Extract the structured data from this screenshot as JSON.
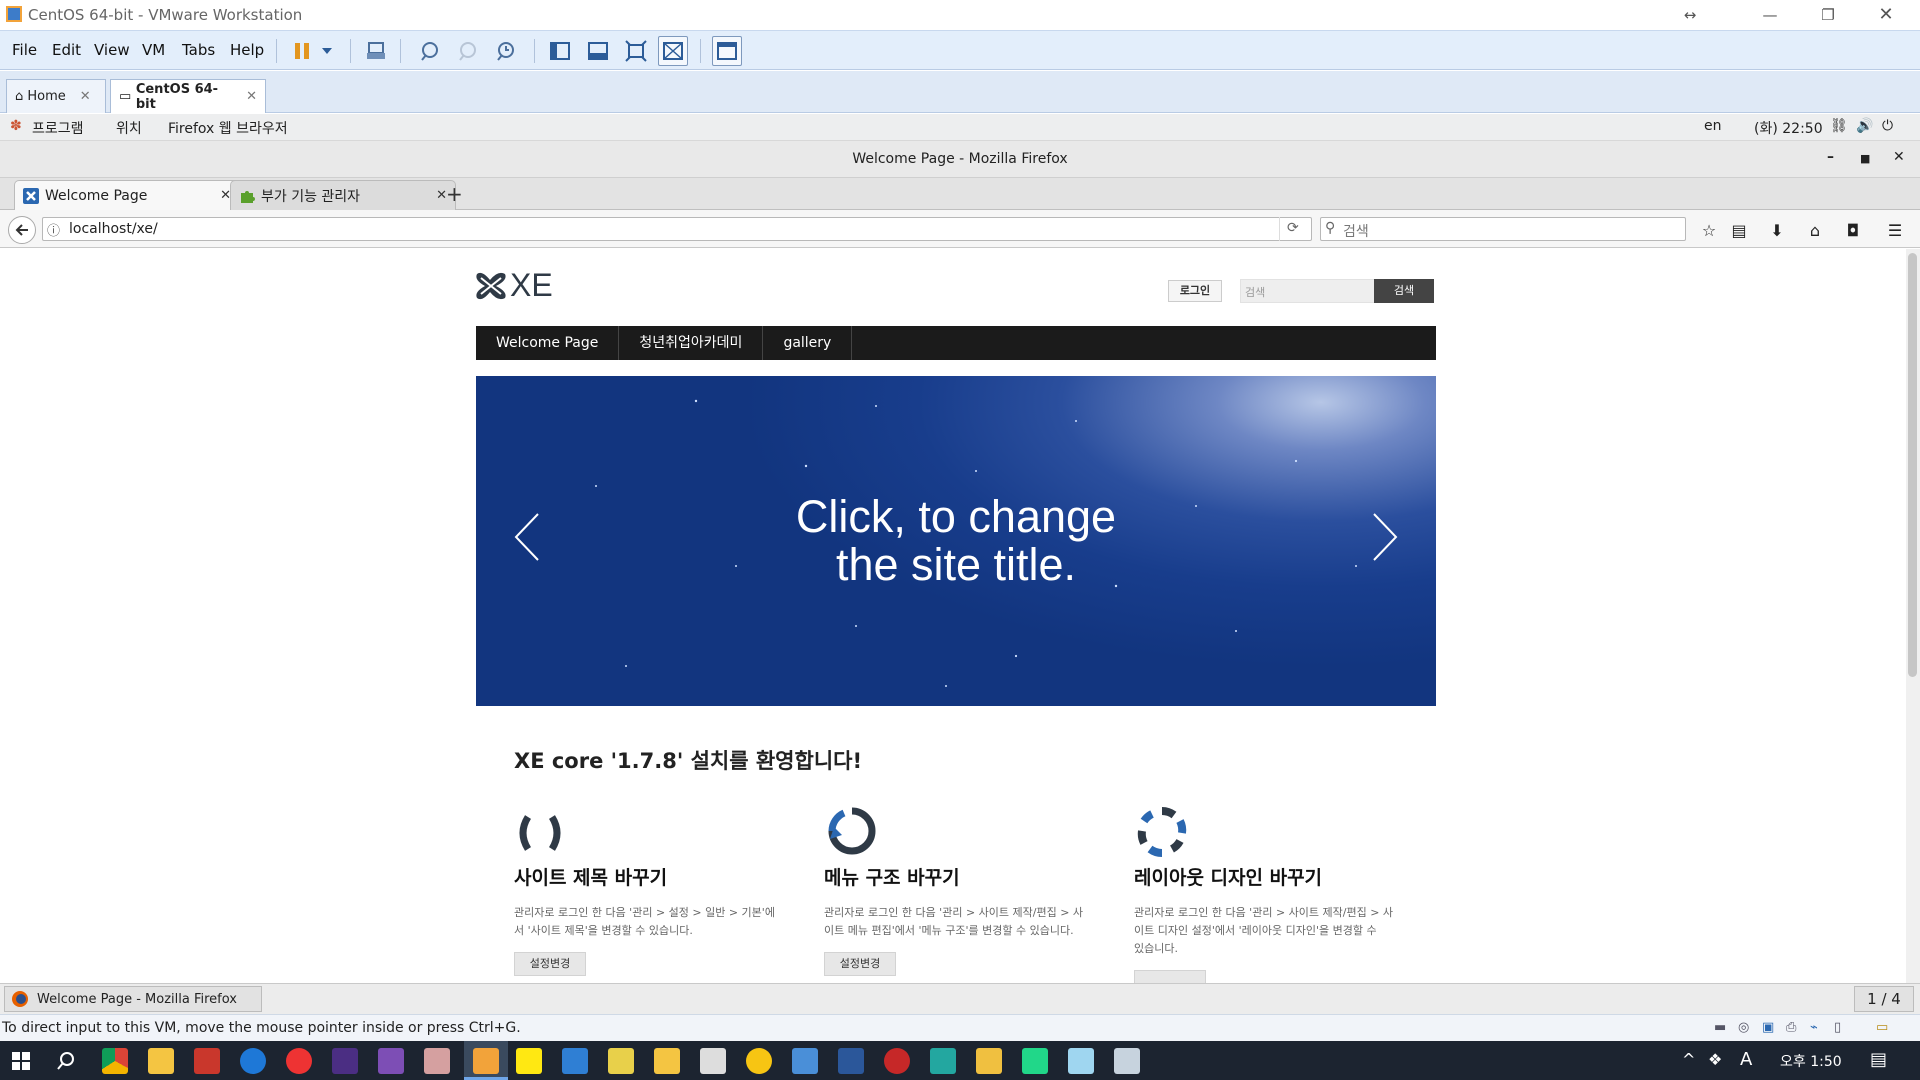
{
  "vmware": {
    "title": "CentOS 64-bit - VMware Workstation",
    "menu": [
      "File",
      "Edit",
      "View",
      "VM",
      "Tabs",
      "Help"
    ],
    "tabs": [
      {
        "label": "Home"
      },
      {
        "label": "CentOS 64-bit",
        "active": true
      }
    ],
    "status_message": "To direct input to this VM, move the mouse pointer inside or press Ctrl+G."
  },
  "gnome": {
    "applications": "프로그램",
    "places": "위치",
    "active_app": "Firefox 웹 브라우저",
    "lang": "en",
    "clock": "(화) 22:50"
  },
  "firefox": {
    "window_title": "Welcome Page - Mozilla Firefox",
    "tabs": [
      {
        "label": "Welcome Page",
        "active": true
      },
      {
        "label": "부가 기능 관리자"
      }
    ],
    "url": "localhost/xe/",
    "search_placeholder": "검색",
    "taskbar_item": "Welcome Page - Mozilla Firefox",
    "workspace": "1 / 4"
  },
  "page": {
    "logo_text": "XE",
    "login_button": "로그인",
    "search_placeholder": "검색",
    "search_button": "검색",
    "nav": [
      "Welcome Page",
      "청년취업아카데미",
      "gallery"
    ],
    "slider_title_line1": "Click, to change",
    "slider_title_line2": "the site title.",
    "welcome_heading": "XE core '1.7.8' 설치를 환영합니다!",
    "columns": [
      {
        "title": "사이트 제목 바꾸기",
        "desc_line1": "관리자로 로그인 한 다음 '관리 > 설정 > 일반 > 기본'에",
        "desc_line2": "서 '사이트 제목'을 변경할 수 있습니다.",
        "desc_line3": "",
        "button": "설정변경"
      },
      {
        "title": "메뉴 구조 바꾸기",
        "desc_line1": "관리자로 로그인 한 다음 '관리 > 사이트 제작/편집 > 사",
        "desc_line2": "이트 메뉴 편집'에서 '메뉴 구조'를 변경할 수 있습니다.",
        "desc_line3": "",
        "button": "설정변경"
      },
      {
        "title": "레이아웃 디자인 바꾸기",
        "desc_line1": "관리자로 로그인 한 다음 '관리 > 사이트 제작/편집 > 사",
        "desc_line2": "이트 디자인 설정'에서 '레이아웃 디자인'을 변경할 수",
        "desc_line3": "있습니다.",
        "button": ""
      }
    ]
  },
  "windows": {
    "time_ampm": "오후 1:50",
    "ime": "A"
  },
  "colors": {
    "accent": "#2b68b1",
    "nav_bg": "#1b1b1b",
    "slider": "#183d8c"
  }
}
